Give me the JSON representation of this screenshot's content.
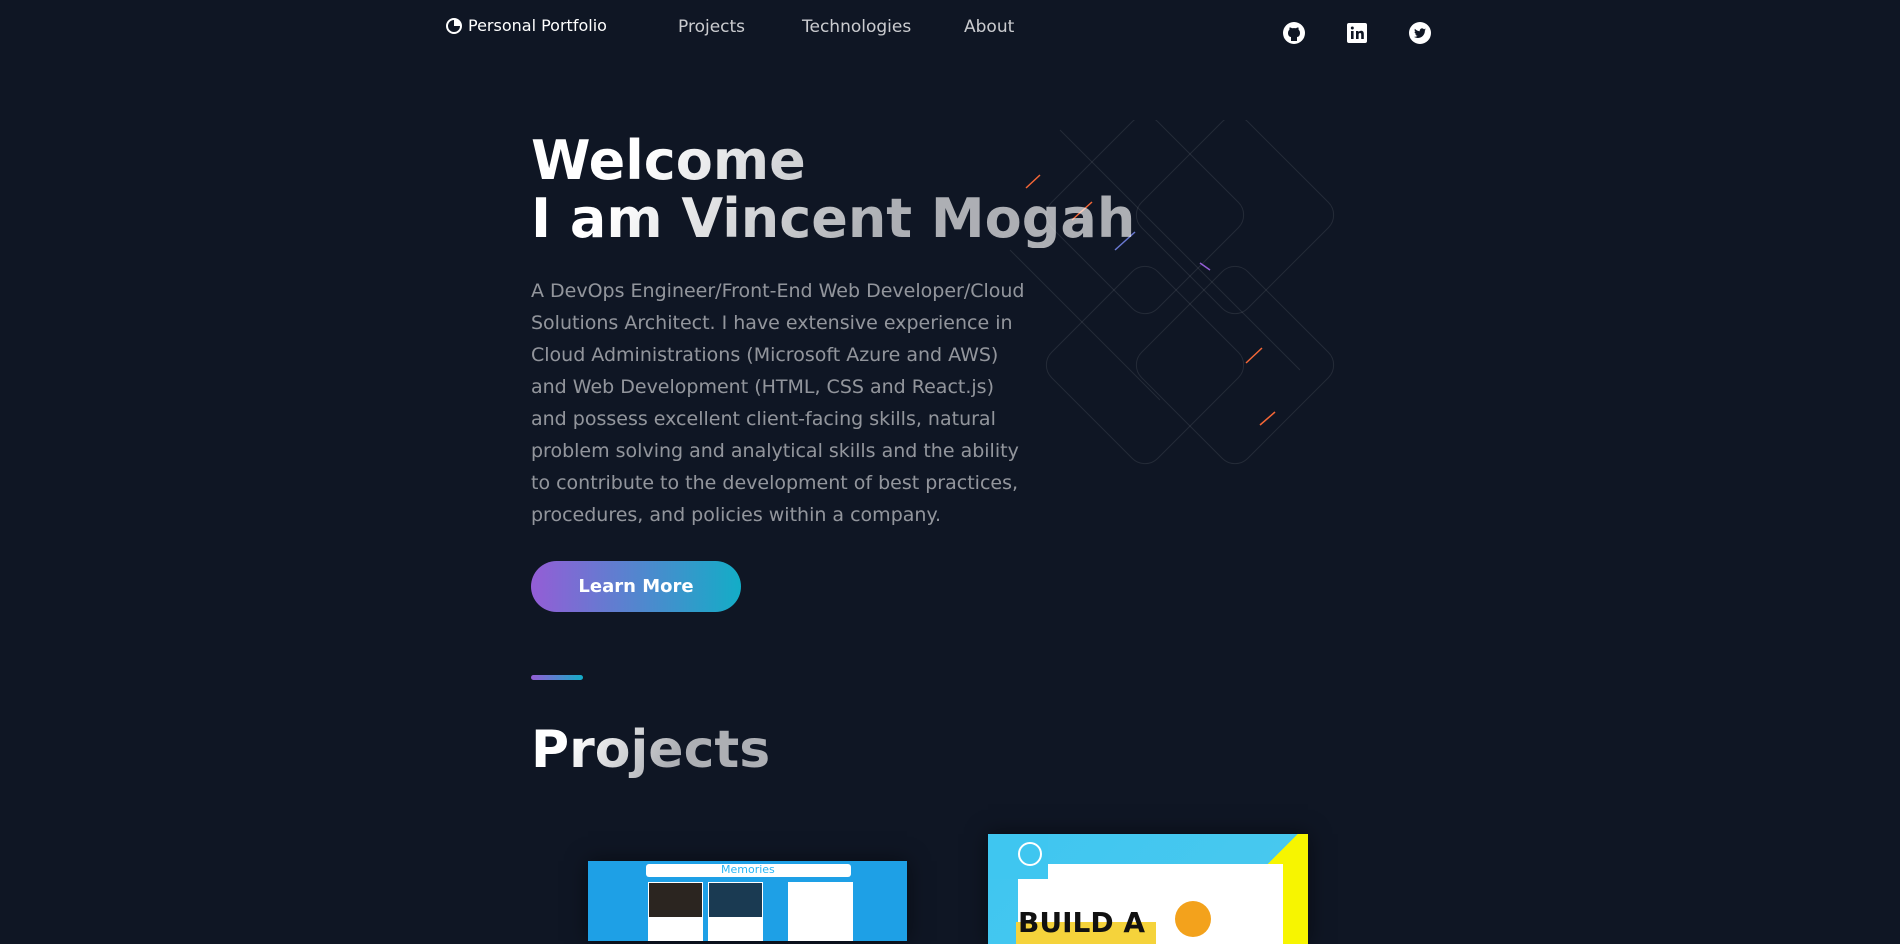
{
  "nav": {
    "brand": "Personal Portfolio",
    "links": [
      "Projects",
      "Technologies",
      "About"
    ],
    "social": [
      "github-icon",
      "linkedin-icon",
      "twitter-icon"
    ]
  },
  "hero": {
    "title_line1": "Welcome",
    "title_line2": "I am Vincent Mogah",
    "description": "A DevOps Engineer/Front-End Web Developer/Cloud Solutions Architect. I have extensive experience in Cloud Administrations (Microsoft Azure and AWS) and Web Development (HTML, CSS and React.js) and possess excellent client-facing skills, natural problem solving and analytical skills and the ability to contribute to the development of best practices, procedures, and policies within a company.",
    "button_label": "Learn More"
  },
  "projects": {
    "title": "Projects",
    "cards": [
      {
        "preview_title": "Memories"
      },
      {
        "preview_title": "BUILD A"
      }
    ]
  },
  "colors": {
    "background": "#0f1624",
    "gradient_start": "#945dd6",
    "gradient_end": "#13adc7"
  }
}
